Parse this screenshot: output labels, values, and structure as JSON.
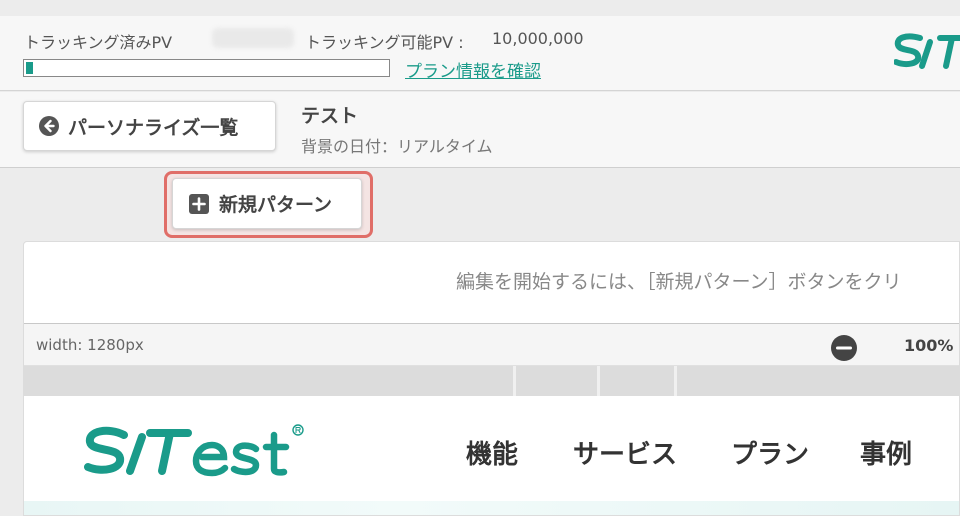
{
  "tracking": {
    "tracked_label": "トラッキング済みPV",
    "tracked_value": "",
    "trackable_label": "トラッキング可能PV :",
    "trackable_value": "10,000,000",
    "progress_fraction": 0.02,
    "plan_link": "プラン情報を確認"
  },
  "header": {
    "back_label": "パーソナライズ一覧",
    "title": "テスト",
    "background_date": "背景の日付：リアルタイム"
  },
  "actions": {
    "new_pattern_label": "新規パターン"
  },
  "editor": {
    "instruction": "編集を開始するには、［新規パターン］ボタンをクリ",
    "width_label": "width: 1280px",
    "zoom_level": "100% ▾"
  },
  "preview": {
    "nav": [
      "機能",
      "サービス",
      "プラン",
      "事例"
    ]
  },
  "colors": {
    "accent": "#1a9b8a",
    "highlight": "#e06e68"
  }
}
